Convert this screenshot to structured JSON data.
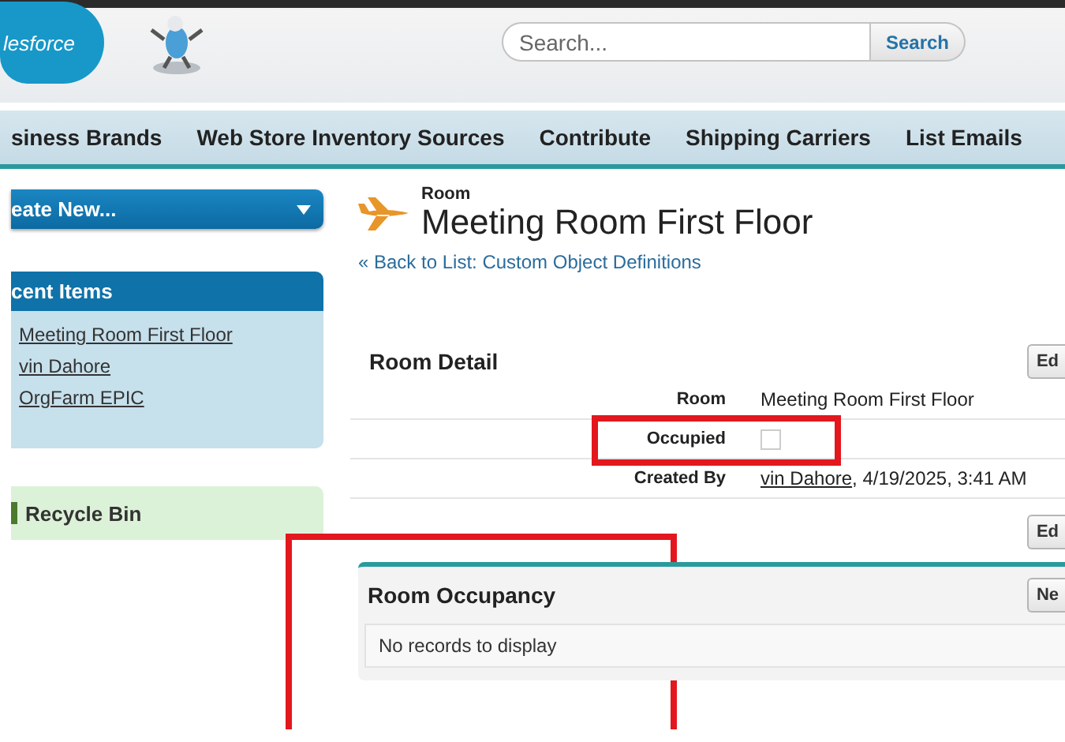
{
  "header": {
    "logo_text": "lesforce",
    "search": {
      "placeholder": "Search...",
      "button": "Search"
    }
  },
  "nav_tabs": [
    {
      "label": "siness Brands",
      "selected": false
    },
    {
      "label": "Web Store Inventory Sources",
      "selected": false
    },
    {
      "label": "Contribute",
      "selected": false
    },
    {
      "label": "Shipping Carriers",
      "selected": false
    },
    {
      "label": "List Emails",
      "selected": false
    }
  ],
  "sidebar": {
    "create_button": "eate New...",
    "recent_items": {
      "title": "cent Items",
      "items": [
        "Meeting Room First Floor",
        "vin Dahore",
        "OrgFarm EPIC"
      ]
    },
    "recycle_bin": "Recycle Bin"
  },
  "record": {
    "type": "Room",
    "title": "Meeting Room First Floor",
    "back_link": "« Back to List: Custom Object Definitions"
  },
  "detail": {
    "title": "Room Detail",
    "top_button": "Ed",
    "bottom_button": "Ed",
    "fields": [
      {
        "label": "Room",
        "kind": "text",
        "value": "Meeting Room First Floor",
        "highlighted": false
      },
      {
        "label": "Occupied",
        "kind": "checkbox",
        "checked": false,
        "highlighted": true
      },
      {
        "label": "Created By",
        "kind": "link",
        "link": "vin Dahore",
        "value": ", 4/19/2025, 3:41 AM",
        "highlighted": false
      }
    ]
  },
  "related_list": {
    "title": "Room Occupancy",
    "button": "Ne",
    "empty_text": "No records to display",
    "highlighted": true
  }
}
